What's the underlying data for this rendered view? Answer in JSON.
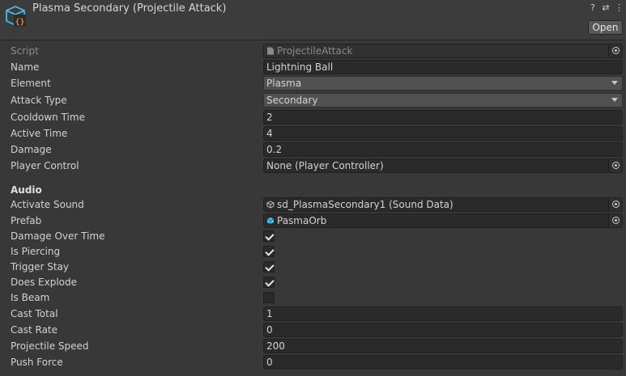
{
  "header": {
    "title": "Plasma Secondary (Projectile Attack)",
    "help_icon": "?",
    "settings_icon": "⇄",
    "menu_icon": "⋮",
    "open_label": "Open"
  },
  "fields": {
    "script": {
      "label": "Script",
      "value": "ProjectileAttack"
    },
    "name": {
      "label": "Name",
      "value": "Lightning Ball"
    },
    "element": {
      "label": "Element",
      "value": "Plasma"
    },
    "attack_type": {
      "label": "Attack Type",
      "value": "Secondary"
    },
    "cooldown_time": {
      "label": "Cooldown Time",
      "value": "2"
    },
    "active_time": {
      "label": "Active Time",
      "value": "4"
    },
    "damage": {
      "label": "Damage",
      "value": "0.2"
    },
    "player_control": {
      "label": "Player Control",
      "value": "None (Player Controller)"
    }
  },
  "audio": {
    "section_label": "Audio",
    "activate_sound": {
      "label": "Activate Sound",
      "value": "sd_PlasmaSecondary1 (Sound Data)"
    },
    "prefab": {
      "label": "Prefab",
      "value": "PasmaOrb"
    },
    "damage_over_time": {
      "label": "Damage Over Time",
      "checked": true
    },
    "is_piercing": {
      "label": "Is Piercing",
      "checked": true
    },
    "trigger_stay": {
      "label": "Trigger Stay",
      "checked": true
    },
    "does_explode": {
      "label": "Does Explode",
      "checked": true
    },
    "is_beam": {
      "label": "Is Beam",
      "checked": false
    },
    "cast_total": {
      "label": "Cast Total",
      "value": "1"
    },
    "cast_rate": {
      "label": "Cast Rate",
      "value": "0"
    },
    "projectile_speed": {
      "label": "Projectile Speed",
      "value": "200"
    },
    "push_force": {
      "label": "Push Force",
      "value": "0"
    }
  },
  "colors": {
    "accent_cyan": "#4fc3f7",
    "accent_orange": "#e8833a"
  }
}
